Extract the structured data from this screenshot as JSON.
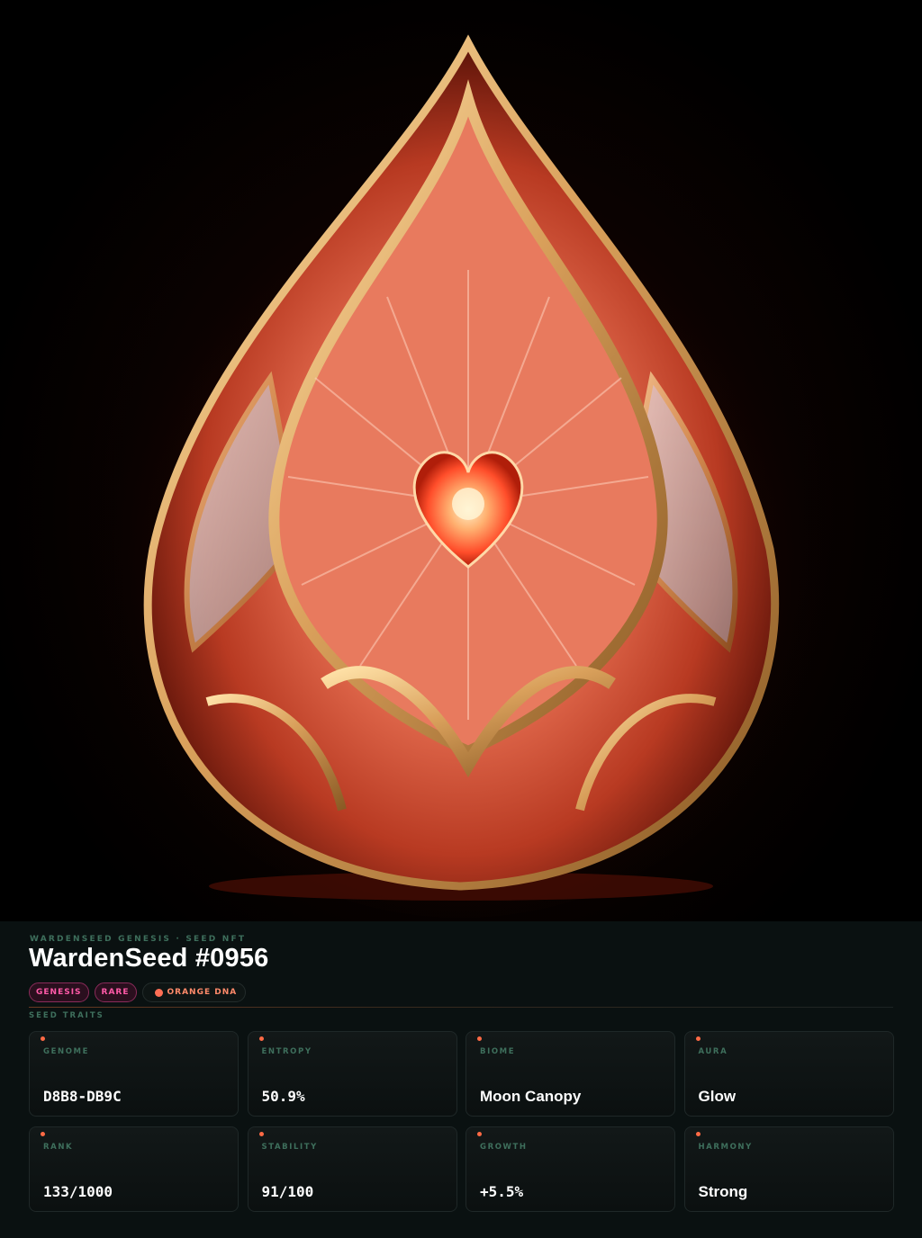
{
  "artwork": {
    "subject": "ruby-heart-seed-gem"
  },
  "header": {
    "collection": "WARDENSEED GENESIS · SEED NFT",
    "title": "WardenSeed #0956"
  },
  "tags": [
    {
      "label": "GENESIS"
    },
    {
      "label": "RARE"
    },
    {
      "label": "ORANGE DNA"
    }
  ],
  "traits_label": "SEED TRAITS",
  "traits": [
    {
      "key": "GENOME",
      "value": "D8B8-DB9C"
    },
    {
      "key": "ENTROPY",
      "value": "50.9%"
    },
    {
      "key": "BIOME",
      "value": "Moon Canopy"
    },
    {
      "key": "AURA",
      "value": "Glow"
    },
    {
      "key": "RANK",
      "value": "133/1000"
    },
    {
      "key": "STABILITY",
      "value": "91/100"
    },
    {
      "key": "GROWTH",
      "value": "+5.5%"
    },
    {
      "key": "HARMONY",
      "value": "Strong"
    }
  ],
  "colors": {
    "accent": "#ff6a45",
    "pink": "#ff5aa8",
    "panel_bg": "#0a1111",
    "label_green": "#3e6f5c",
    "gold": "#d9a05b"
  }
}
